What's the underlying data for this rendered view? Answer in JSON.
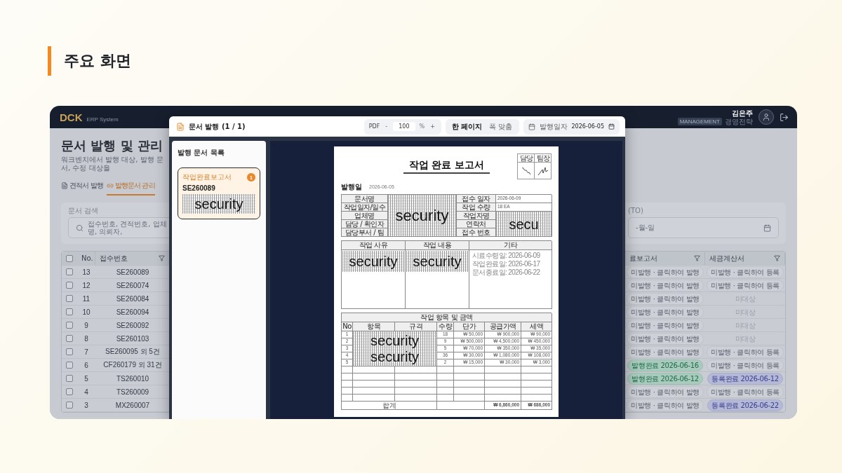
{
  "page_heading": "주요 화면",
  "app": {
    "logo": "DCK",
    "logo_sub": "ERP System",
    "user": {
      "name": "김은주",
      "role_badge": "MANAGEMENT",
      "department": "경영전략"
    }
  },
  "page": {
    "title": "문서 발행 및 관리",
    "subtitle": "워크벤치에서 발행 대상, 발행 문서, 수정 대상을",
    "tabs": [
      {
        "label": "견적서 발행",
        "selected": false
      },
      {
        "label": "발행문서 관리",
        "selected": true
      }
    ],
    "search": {
      "label": "문서 검색",
      "placeholder": "접수번호, 견적번호, 업체명, 의뢰자,"
    },
    "date_filter": {
      "label": "(TO)",
      "placeholder": "-월-일"
    },
    "table": {
      "header_checked": false,
      "columns": [
        {
          "label": "No.",
          "filter": false
        },
        {
          "label": "접수번호",
          "filter": true
        },
        {
          "label": "료보고서",
          "filter": true
        },
        {
          "label": "세금계산서",
          "filter": true
        }
      ],
      "rows": [
        {
          "no": "13",
          "receipt_no": "SE260089",
          "checked": false,
          "report": {
            "kind": "pending",
            "text": "미발행 · 클릭하여 발행"
          },
          "tax": {
            "kind": "pending",
            "text": "미발행 · 클릭하여 등록"
          }
        },
        {
          "no": "12",
          "receipt_no": "SE260074",
          "checked": false,
          "report": {
            "kind": "pending",
            "text": "미발행 · 클릭하여 발행"
          },
          "tax": {
            "kind": "pending",
            "text": "미발행 · 클릭하여 등록"
          }
        },
        {
          "no": "11",
          "receipt_no": "SE260084",
          "checked": false,
          "report": {
            "kind": "pending",
            "text": "미발행 · 클릭하여 발행"
          },
          "tax": {
            "kind": "na",
            "text": "미대상"
          }
        },
        {
          "no": "10",
          "receipt_no": "SE260094",
          "checked": false,
          "report": {
            "kind": "pending",
            "text": "미발행 · 클릭하여 발행"
          },
          "tax": {
            "kind": "na",
            "text": "미대상"
          }
        },
        {
          "no": "9",
          "receipt_no": "SE260092",
          "checked": false,
          "report": {
            "kind": "pending",
            "text": "미발행 · 클릭하여 발행"
          },
          "tax": {
            "kind": "na",
            "text": "미대상"
          }
        },
        {
          "no": "8",
          "receipt_no": "SE260103",
          "checked": false,
          "report": {
            "kind": "pending",
            "text": "미발행 · 클릭하여 발행"
          },
          "tax": {
            "kind": "na",
            "text": "미대상"
          }
        },
        {
          "no": "7",
          "receipt_no": "SE260095 외 5건",
          "checked": false,
          "report": {
            "kind": "pending",
            "text": "미발행 · 클릭하여 발행"
          },
          "tax": {
            "kind": "pending",
            "text": "미발행 · 클릭하여 등록"
          }
        },
        {
          "no": "6",
          "receipt_no": "CF260179 외 31건",
          "checked": false,
          "report": {
            "kind": "issued",
            "text": "발행완료 2026-06-16"
          },
          "tax": {
            "kind": "pending",
            "text": "미발행 · 클릭하여 등록"
          }
        },
        {
          "no": "5",
          "receipt_no": "TS260010",
          "checked": false,
          "report": {
            "kind": "issued",
            "text": "발행완료 2026-06-12"
          },
          "tax": {
            "kind": "registered",
            "text": "등록완료 2026-06-12"
          }
        },
        {
          "no": "4",
          "receipt_no": "TS260009",
          "checked": false,
          "report": {
            "kind": "pending",
            "text": "미발행 · 클릭하여 발행"
          },
          "tax": {
            "kind": "pending",
            "text": "미발행 · 클릭하여 등록"
          }
        },
        {
          "no": "3",
          "receipt_no": "MX260007",
          "checked": false,
          "report": {
            "kind": "pending",
            "text": "미발행 · 클릭하여 발행"
          },
          "tax": {
            "kind": "registered",
            "text": "등록완료 2026-06-22"
          }
        }
      ]
    }
  },
  "modal": {
    "title": "문서 발행 (1 / 1)",
    "format": "PDF",
    "zoom_minus": "-",
    "zoom": "100",
    "zoom_unit": "%",
    "zoom_plus": "+",
    "view_modes": [
      {
        "label": "한 페이지",
        "selected": true
      },
      {
        "label": "폭 맞춤",
        "selected": false
      }
    ],
    "date_label": "발행일자",
    "date": "2026-06-05",
    "list_title": "발행 문서 목록",
    "documents": [
      {
        "type": "작업완료보고서",
        "count": "1",
        "receipt_no": "SE260089",
        "redaction": "security",
        "selected": true
      }
    ]
  },
  "document": {
    "title": "작업 완료 보고서",
    "approvals": [
      {
        "role": "담당"
      },
      {
        "role": "팀장"
      }
    ],
    "issue_label": "발행일",
    "issue_date": "2026-06-05",
    "info_left_labels": [
      "문서명",
      "작업일자/일수",
      "업체명",
      "담당 / 확인자",
      "담당부서 / 팀"
    ],
    "info_left_redaction": "security",
    "info_right": [
      {
        "label": "접수 일자",
        "value": "2026-06-09"
      },
      {
        "label": "작업 수량",
        "value": "18 EA"
      },
      {
        "label": "작업자명"
      },
      {
        "label": "연락처"
      },
      {
        "label": "접수 번호"
      }
    ],
    "info_right_redaction": "secu",
    "work_columns": [
      "작업 사유",
      "작업 내용",
      "기타"
    ],
    "work_redactions": [
      "security",
      "security"
    ],
    "work_notes": [
      "시료수령일: 2026-06-09",
      "작업완료일: 2026-06-17",
      "문서종료일: 2026-06-22"
    ],
    "items_title": "작업 항목 및 금액",
    "item_columns": [
      "No",
      "항목",
      "규격",
      "수량",
      "단가",
      "공급가액",
      "세액"
    ],
    "items": [
      {
        "no": "1",
        "qty": "18",
        "unit_price": "₩ 50,000",
        "supply": "₩ 900,000",
        "tax": "₩ 90,000"
      },
      {
        "no": "2",
        "qty": "9",
        "unit_price": "₩ 500,000",
        "supply": "₩ 4,500,000",
        "tax": "₩ 450,000"
      },
      {
        "no": "3",
        "qty": "5",
        "unit_price": "₩ 70,000",
        "supply": "₩ 350,000",
        "tax": "₩ 35,000"
      },
      {
        "no": "4",
        "qty": "36",
        "unit_price": "₩ 30,000",
        "supply": "₩ 1,080,000",
        "tax": "₩ 108,000"
      },
      {
        "no": "5",
        "qty": "2",
        "unit_price": "₩ 15,000",
        "supply": "₩ 30,000",
        "tax": "₩ 3,000"
      }
    ],
    "items_redactions": [
      "security",
      "security"
    ],
    "total": {
      "label": "합계",
      "supply": "₩ 6,860,000",
      "tax": "₩ 686,000"
    }
  }
}
